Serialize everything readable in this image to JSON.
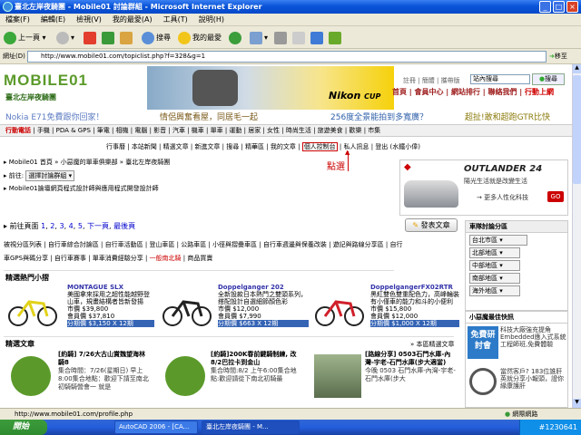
{
  "window": {
    "title": "臺北左岸夜騎團 - Mobile01 討論群組 - Microsoft Internet Explorer",
    "min": "_",
    "max": "□",
    "close": "×"
  },
  "menu": [
    "檔案(F)",
    "編輯(E)",
    "檢視(V)",
    "我的最愛(A)",
    "工具(T)",
    "說明(H)"
  ],
  "toolbar": {
    "back": "上一頁",
    "search": "搜尋",
    "favorites": "我的最愛"
  },
  "address": {
    "label": "網址(D)",
    "url": "http://www.mobile01.com/topiclist.php?f=328&g=1",
    "go": "移至"
  },
  "site": {
    "logo": "MOBILE01",
    "logo_sub": "臺北左岸夜騎團",
    "banner_brand": "Nikon",
    "banner_cup": "CUP",
    "toplinks": [
      "註冊",
      "簡體",
      "攜帶版"
    ],
    "search_value": "站內搜尋",
    "search_btn": "搜尋",
    "nav": [
      "首頁",
      "會員中心",
      "網站排行",
      "聯絡我們",
      "行動上網"
    ],
    "ads": [
      "Nokia E71免費跟你回家！",
      "情侶興奮看屋，同居毛一起",
      "256度全景能拍到多寬廣？",
      "超扯!敢和超跑GTR比快"
    ],
    "cats": [
      "行動電話",
      "電腦",
      "手機",
      "PDA & GPS",
      "筆電",
      "相機",
      "電腦",
      "影音",
      "汽車",
      "機車",
      "單車",
      "運動",
      "居家",
      "女性",
      "時尚生活",
      "旅遊美食",
      "歡樂",
      "市集"
    ],
    "subnav": [
      "行事曆",
      "本站新聞",
      "精選文章",
      "新進文章",
      "搜尋",
      "精華區",
      "我的文章",
      "個人控制台",
      "私人訊息",
      "登出 (水鐵小偉)"
    ],
    "annotation": "點選"
  },
  "breadcrumb": {
    "text": "Mobile01 首頁 » 小惡魔的單車俱樂部 » 臺北左岸夜騎團",
    "goto_label": "前往:",
    "goto_value": "選擇討論群組",
    "desc": "Mobile01論壇網頁程式設計師與應用程式開發設計師"
  },
  "pager": {
    "prev": "前往頁面",
    "pages": [
      "1",
      "2",
      "3",
      "4",
      "5",
      "下一頁",
      "最後頁"
    ],
    "post_btn": "發表文章"
  },
  "categories": {
    "rows": [
      [
        "被視分區列表",
        "自行車綜合討論區",
        "自行車活動區",
        "登山車區",
        "公路車區",
        "小徑與摺疊車區",
        "自行車週邊與保養改裝",
        "遊記與路線分享區",
        "自行"
      ],
      [
        "車GPS與碼分享",
        "自行車賽事",
        "單車消費經驗分享",
        "一般南北騎",
        "商品買賣"
      ]
    ]
  },
  "hot": {
    "title": "精選熱門小摺",
    "items": [
      {
        "name": "MONTAGUE SLX",
        "desc": "美國拿來採用之超性能越野登山車，規畫結構者皆新發揚",
        "market": "市價 $39,800",
        "member": "會員價 $37,810",
        "sale": "分期價 $3,150 X 12期"
      },
      {
        "name": "Doppelganger 202",
        "desc": "全新設款日本熱門之雙頭系列，搭配設計自選細節顏色彩",
        "market": "市價 $12,000",
        "member": "會員價 $7,990",
        "sale": "分期價 $663 X 12期"
      },
      {
        "name": "DoppelgangerFX02RTR",
        "desc": "黑紅雙色雙重配色力，高峰輪裝有小僅車的能力和斗的小便利",
        "market": "市價 $15,800",
        "member": "會員價 $12,000",
        "sale": "分期價 $1,000 X 12期"
      }
    ]
  },
  "featured": {
    "title": "精選文章",
    "more": "» 本區精選文章",
    "items": [
      {
        "title": "[約騎] 7/26大古山賞魏望海林騎8",
        "desc": "集合時間：7/26(星期日) 早上8:00集合地點：歡迎下請至南北初騎騎營會一 就是"
      },
      {
        "title": "[約騎]200K春前鍵騎制練, 改8/2巴拉卡到金山",
        "desc": "集合時間:8/2 上午6:00集合地點:歡迎請從下南北初騎最"
      },
      {
        "title": "[路線分享] 0503石門水庫-內灣-宇老-石門水庫(步大適當)",
        "desc": "今晚 0503 石門水庫-內灣-宇老-石門水庫(步大"
      }
    ]
  },
  "right": {
    "mitsu": "OUTLANDER 24",
    "mitsu_sub": "陽光生活就是改變生活",
    "mitsu_link": "→ 更多人性化科技",
    "mitsu_go": "GO",
    "region_title": "車隊討論分區",
    "regions": [
      "台北市區",
      "北部地區",
      "中部地區",
      "南部地區",
      "海外地區"
    ],
    "devil_title": "小惡魔最佳快訊",
    "news": [
      {
        "badge": "免費研討會",
        "text": "科技大廠強充提角 Embedded應入式系統工程師班,免費體驗"
      },
      {
        "badge": "",
        "text": "當然客戶? 183位誰肝英就分享小報頭，證你緣康護肝"
      }
    ]
  },
  "status": {
    "text": "http://www.mobile01.com/profile.php",
    "zone": "網際網路"
  },
  "taskbar": {
    "start": "開始",
    "tasks": [
      "AutoCAD 2006 - [CA...",
      "臺北左岸夜騎團 - M..."
    ],
    "watermark": "#1230641"
  }
}
